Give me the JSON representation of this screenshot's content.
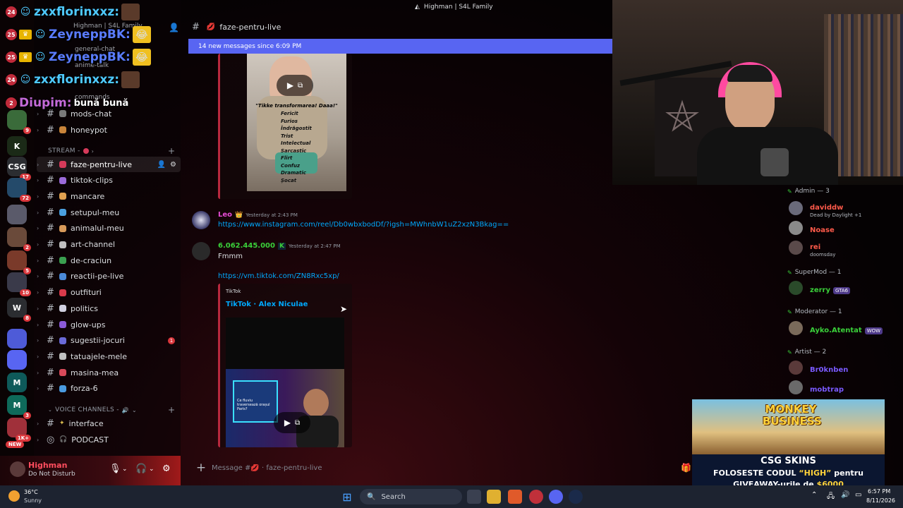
{
  "window": {
    "title": "Highman | S4L Family"
  },
  "servers": [
    {
      "label": "",
      "badge": "9",
      "color": "#3a6b3a"
    },
    {
      "label": "K",
      "badge": "",
      "color": "#1b2a17"
    },
    {
      "label": "CSG",
      "badge": "17",
      "color": "#2b2d31"
    },
    {
      "label": "",
      "badge": "72",
      "color": "#244a6a"
    },
    {
      "label": "",
      "badge": "",
      "color": "#5a5a6a"
    },
    {
      "label": "",
      "badge": "2",
      "color": "#6a4a3a"
    },
    {
      "label": "",
      "badge": "5",
      "color": "#7a3a2a"
    },
    {
      "label": "",
      "badge": "10",
      "color": "#3a3a4a"
    },
    {
      "label": "W",
      "badge": "8",
      "color": "#2b2d31"
    },
    {
      "label": "",
      "badge": "",
      "color": "#4e5bd8"
    },
    {
      "label": "",
      "badge": "",
      "color": "#5865f2"
    },
    {
      "label": "M",
      "badge": "",
      "color": "#0e5a5a"
    },
    {
      "label": "M",
      "badge": "3",
      "color": "#0e6a5a"
    },
    {
      "label": "",
      "badge": "1K+",
      "color": "#a0303a"
    }
  ],
  "new_server_badge": "NEW",
  "overlay_chat": [
    {
      "level": "24",
      "name": "zxxflorinxxz:",
      "name_color": "#4ec9ff",
      "message": "",
      "crown": false
    },
    {
      "level": "25",
      "name": "ZeyneppBK:",
      "name_color": "#5a7cff",
      "message": "",
      "crown": true
    },
    {
      "level": "25",
      "name": "ZeyneppBK:",
      "name_color": "#5a7cff",
      "message": "",
      "crown": true
    },
    {
      "level": "24",
      "name": "zxxflorinxxz:",
      "name_color": "#4ec9ff",
      "message": "",
      "crown": false
    },
    {
      "level": "2",
      "name": "Diupim:",
      "name_color": "#c46ad8",
      "message": "bună bună",
      "crown": false
    }
  ],
  "channels_hidden": [
    "Highman | S4L Family",
    "general-chat",
    "anime-talk",
    "commands"
  ],
  "channels": [
    {
      "name": "mods-chat",
      "emo": "#7a7a7a"
    },
    {
      "name": "honeypot",
      "emo": "#c8843a"
    },
    {
      "name": "faze-pentru-live",
      "emo": "#d63a5a",
      "active": true
    },
    {
      "name": "tiktok-clips",
      "emo": "#9a6ad8"
    },
    {
      "name": "mancare",
      "emo": "#e0a050"
    },
    {
      "name": "setupul-meu",
      "emo": "#4aa0e0"
    },
    {
      "name": "animalul-meu",
      "emo": "#d89a5a"
    },
    {
      "name": "art-channel",
      "emo": "#c0c0c0"
    },
    {
      "name": "de-craciun",
      "emo": "#3aa050"
    },
    {
      "name": "reactii-pe-live",
      "emo": "#4a8ad8"
    },
    {
      "name": "outfituri",
      "emo": "#d83a4a"
    },
    {
      "name": "politics",
      "emo": "#d0d0e0"
    },
    {
      "name": "glow-ups",
      "emo": "#8a5ad8"
    },
    {
      "name": "sugestii-jocuri",
      "emo": "#6a6ad8",
      "badge": "1"
    },
    {
      "name": "tatuajele-mele",
      "emo": "#c0c0c0"
    },
    {
      "name": "masina-mea",
      "emo": "#d84a5a"
    },
    {
      "name": "forza-6",
      "emo": "#4a9ae0"
    }
  ],
  "categories": {
    "stream": "STREAM -",
    "voice": "VOICE CHANNELS -"
  },
  "voice_channels": [
    {
      "name": "interface"
    },
    {
      "name": "PODCAST"
    }
  ],
  "user": {
    "name": "Highman",
    "status": "Do Not Disturb"
  },
  "chat": {
    "channel": "faze-pentru-live",
    "new_messages": "14 new messages since 6:09 PM",
    "embed1_caption": "\"Tikke transformarea! Daaa!\"",
    "embed1_lines": [
      "Fericit",
      "Furios",
      "Îndrăgostit",
      "Trist",
      "Intelectual",
      "Sarcastic",
      "Flirt",
      "Confuz",
      "Dramatic",
      "Șocat"
    ],
    "msg1": {
      "author": "Leo",
      "time": "Yesterday at 2:43 PM",
      "link": "https://www.instagram.com/reel/Db0wbxbodDf/?igsh=MWhnbW1uZ2xzN3Bkag=="
    },
    "msg2": {
      "author": "6.062.445.000",
      "time": "Yesterday at 2:47 PM",
      "text": "Fmmm",
      "link": "https://vm.tiktok.com/ZN8Rxc5xp/"
    },
    "embed2": {
      "provider": "TikTok",
      "title": "TikTok · Alex Niculae",
      "thumb_text": "Ce fluviu traversează orașul Paris?"
    },
    "composer_placeholder": "Message #💋 · faze-pentru-live"
  },
  "members": {
    "roles": [
      {
        "label": "Admin — 3",
        "color": "#b5bac1"
      },
      {
        "label": "SuperMod — 1",
        "color": "#b5bac1"
      },
      {
        "label": "Moderator — 1",
        "color": "#b5bac1"
      },
      {
        "label": "Artist — 2",
        "color": "#b5bac1"
      }
    ],
    "list": [
      {
        "name": "daviddw",
        "sub": "Dead by Daylight +1",
        "color": "#ff5a4a",
        "avatar": "#6a6a7a"
      },
      {
        "name": "Noase",
        "sub": "",
        "color": "#ff5a4a",
        "avatar": "#8a8a8a"
      },
      {
        "name": "rei",
        "sub": "doomsday",
        "color": "#ff5a4a",
        "avatar": "#5a4a4a"
      },
      {
        "name": "zerry",
        "sub": "",
        "tag": "GTA6",
        "color": "#3ad03a",
        "avatar": "#2a4a2a"
      },
      {
        "name": "Ayko.Atentat",
        "sub": "",
        "tag": "WOW",
        "color": "#3ad03a",
        "avatar": "#7a6a5a"
      },
      {
        "name": "Br0knben",
        "sub": "",
        "color": "#7a5aff",
        "avatar": "#5a3a3a"
      },
      {
        "name": "mobtrap",
        "sub": "",
        "color": "#7a5aff",
        "avatar": "#6a6a6a"
      }
    ]
  },
  "sponsor": {
    "game_title": "MONKEY BUSINESS",
    "brand": "CSG SKINS",
    "line1_a": "FOLOSESTE CODUL",
    "line1_code": "“HIGH”",
    "line1_b": "pentru",
    "line2_a": "GIVEAWAY-urile de",
    "line2_amount": "$6000"
  },
  "taskbar": {
    "weather_temp": "36°C",
    "weather_desc": "Sunny",
    "search_label": "Search",
    "time": "6:57 PM",
    "date": "8/11/2026"
  },
  "colors": {
    "accent": "#5865f2",
    "link": "#00a8fc",
    "danger": "#da373c"
  }
}
